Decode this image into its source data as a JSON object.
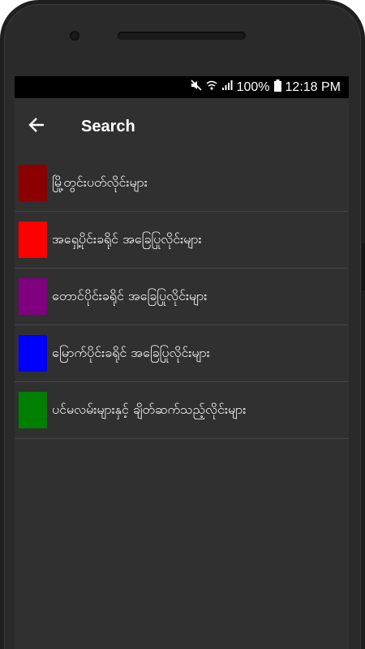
{
  "status_bar": {
    "battery": "100%",
    "time": "12:18 PM",
    "icons": [
      "mute-icon",
      "wifi-icon",
      "signal-icon",
      "battery-icon"
    ]
  },
  "app_bar": {
    "title": "Search",
    "back_icon": "arrow-left-icon"
  },
  "items": [
    {
      "label": "မြို့တွင်းပတ်လိုင်းများ",
      "color": "#8b0000"
    },
    {
      "label": "အရှေ့ပိုင်းခရိုင် အခြေပြုလိုင်းများ",
      "color": "#ff0000"
    },
    {
      "label": "တောင်ပိုင်းခရိုင် အခြေပြုလိုင်းများ",
      "color": "#800080"
    },
    {
      "label": "မြောက်ပိုင်းခရိုင် အခြေပြုလိုင်းများ",
      "color": "#0000ff"
    },
    {
      "label": "ပင်မလမ်းများနှင့် ချိတ်ဆက်သည့်လိုင်းများ",
      "color": "#008000"
    }
  ]
}
